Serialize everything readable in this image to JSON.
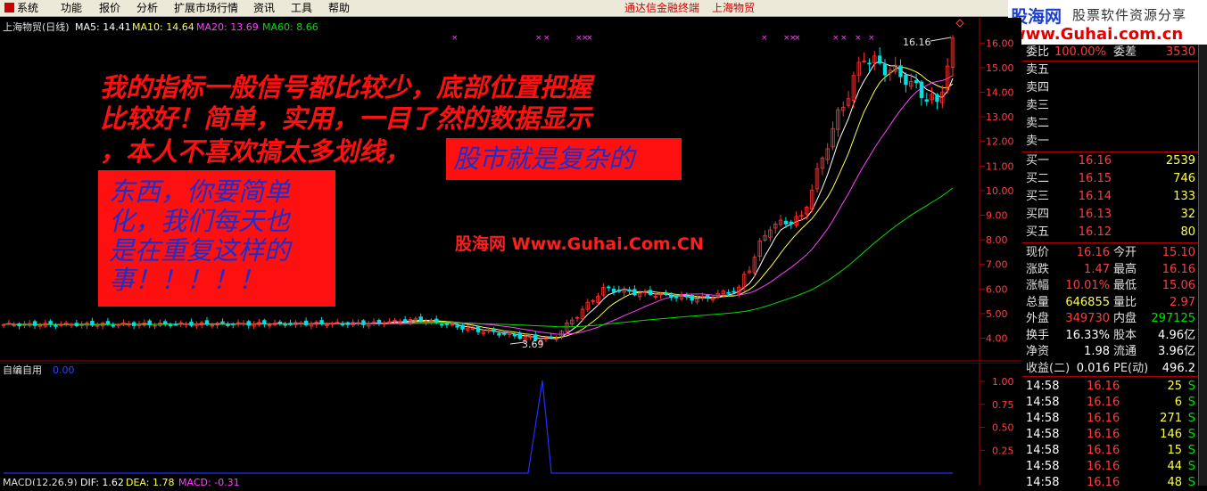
{
  "menu": {
    "items": [
      "系统",
      "功能",
      "报价",
      "分析",
      "扩展市场行情",
      "资讯",
      "工具",
      "帮助"
    ],
    "app_title": "通达信金融终端",
    "stock_title": "上海物贸"
  },
  "logo": {
    "brand": "股海网",
    "tagline": "股票软件资源分享",
    "url": "www.Guhai.com.cn"
  },
  "main_chart": {
    "legend": {
      "name": "上海物贸(日线)",
      "ma5": "MA5: 14.41",
      "ma10": "MA10: 14.64",
      "ma20": "MA20: 13.69",
      "ma60": "MA60: 8.66"
    },
    "high_label": "16.16",
    "low_label": "3.69",
    "y_ticks": [
      "16.00",
      "15.00",
      "14.00",
      "13.00",
      "12.00",
      "11.00",
      "10.00",
      "9.00",
      "8.00",
      "7.00",
      "6.00",
      "5.00",
      "4.00"
    ],
    "colors": {
      "up": "#ff3232",
      "down": "#00e0e0",
      "ma5": "#ffffff",
      "ma10": "#ffff40",
      "ma20": "#ff40ff",
      "ma60": "#00e000"
    }
  },
  "overlay": {
    "line1": "我的指标一般信号都比较少，底部位置把握",
    "line2": "比较好！简单，实用，一目了然的数据显示",
    "line3": "，本人不喜欢搞太多划线，",
    "box_small": "股市就是复杂的",
    "box_big_lines": [
      "东西，你要简单",
      "化，我们每天也",
      "是在重复这样的",
      "事！！！！！"
    ],
    "watermark": "股海网 Www.Guhai.Com.CN"
  },
  "sub_chart": {
    "name": "自编自用",
    "value": "0.00",
    "y_ticks": [
      "1.00",
      "0.75",
      "0.50",
      "0.25"
    ],
    "macd_label": "MACD(12,26,9)",
    "dif": "DIF: 1.62",
    "dea": "DEA: 1.78",
    "macd": "MACD: -0.31"
  },
  "quote": {
    "top_row": {
      "label": "委比",
      "value": "100.00%",
      "label2": "委差",
      "value2": "3530"
    },
    "sell": [
      {
        "label": "卖五"
      },
      {
        "label": "卖四"
      },
      {
        "label": "卖三"
      },
      {
        "label": "卖二"
      },
      {
        "label": "卖一"
      }
    ],
    "buy": [
      {
        "label": "买一",
        "price": "16.16",
        "vol": "2539"
      },
      {
        "label": "买二",
        "price": "16.15",
        "vol": "746"
      },
      {
        "label": "买三",
        "price": "16.14",
        "vol": "133"
      },
      {
        "label": "买四",
        "price": "16.13",
        "vol": "32"
      },
      {
        "label": "买五",
        "price": "16.12",
        "vol": "80"
      }
    ],
    "stats": [
      {
        "l1": "现价",
        "v1": "16.16",
        "l2": "今开",
        "v2": "15.10",
        "c1": "red",
        "c2": "red"
      },
      {
        "l1": "涨跌",
        "v1": "1.47",
        "l2": "最高",
        "v2": "16.16",
        "c1": "red",
        "c2": "red"
      },
      {
        "l1": "涨幅",
        "v1": "10.01%",
        "l2": "最低",
        "v2": "15.06",
        "c1": "red",
        "c2": "red"
      },
      {
        "l1": "总量",
        "v1": "646855",
        "l2": "量比",
        "v2": "2.97",
        "c1": "yellow",
        "c2": "red"
      },
      {
        "l1": "外盘",
        "v1": "349730",
        "l2": "内盘",
        "v2": "297125",
        "c1": "red",
        "c2": "green"
      },
      {
        "l1": "换手",
        "v1": "16.33%",
        "l2": "股本",
        "v2": "4.96亿",
        "c1": "white",
        "c2": "white"
      },
      {
        "l1": "净资",
        "v1": "1.98",
        "l2": "流通",
        "v2": "3.96亿",
        "c1": "white",
        "c2": "white"
      },
      {
        "l1": "收益(二)",
        "v1": "0.016",
        "l2": "PE(动)",
        "v2": "496.2",
        "c1": "white",
        "c2": "white"
      }
    ],
    "ticks": [
      {
        "time": "14:58",
        "price": "16.16",
        "vol": "25",
        "side": "S"
      },
      {
        "time": "14:58",
        "price": "16.16",
        "vol": "6",
        "side": "S"
      },
      {
        "time": "14:58",
        "price": "16.16",
        "vol": "271",
        "side": "S"
      },
      {
        "time": "14:58",
        "price": "16.16",
        "vol": "146",
        "side": "S"
      },
      {
        "time": "14:58",
        "price": "16.16",
        "vol": "15",
        "side": "S"
      },
      {
        "time": "14:58",
        "price": "16.16",
        "vol": "44",
        "side": "S"
      },
      {
        "time": "14:58",
        "price": "16.16",
        "vol": "48",
        "side": "S"
      }
    ]
  }
}
